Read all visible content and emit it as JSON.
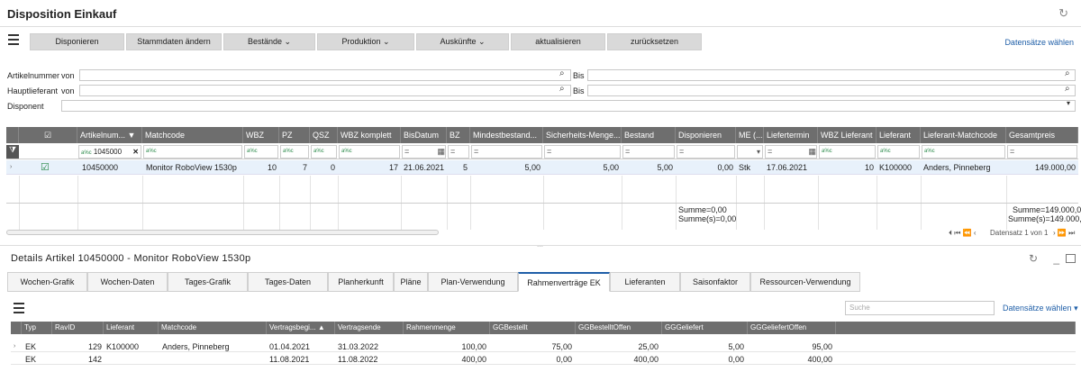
{
  "window": {
    "title": "Disposition Einkauf"
  },
  "toolbar": {
    "buttons": [
      "Disponieren",
      "Stammdaten ändern",
      "Bestände",
      "Produktion",
      "Auskünfte",
      "aktualisieren",
      "zurücksetzen"
    ],
    "datensaetze": "Datensätze wählen"
  },
  "filters": {
    "artikelnummer": "Artikelnummer",
    "hauptlieferant": "Hauptlieferant",
    "von": "von",
    "bis": "Bis",
    "disponent": "Disponent"
  },
  "grid": {
    "columns": [
      "Artikelnum...",
      "Matchcode",
      "WBZ",
      "PZ",
      "QSZ",
      "WBZ komplett",
      "BisDatum",
      "BZ",
      "Mindestbestand...",
      "Sicherheits-Menge...",
      "Bestand",
      "Disponieren",
      "ME (...",
      "Liefertermin",
      "WBZ Lieferant",
      "Lieferant",
      "Lieferant-Matchcode",
      "Gesamtpreis"
    ],
    "filter_artikel": "1045000",
    "row": {
      "artikel": "10450000",
      "matchcode": "Monitor RoboView 1530p",
      "wbz": "10",
      "pz": "7",
      "qsz": "0",
      "wbz_komplett": "17",
      "bisdatum": "21.06.2021",
      "bz": "5",
      "mindestbestand": "5,00",
      "sicherheit": "5,00",
      "bestand": "5,00",
      "disponieren": "0,00",
      "me": "Stk",
      "liefertermin": "17.06.2021",
      "wbz_lieferant": "10",
      "lieferant": "K100000",
      "lieferant_match": "Anders, Pinneberg",
      "gesamtpreis": "149.000,00"
    },
    "sum_disp_1": "Summe=0,00",
    "sum_disp_2": "Summe(s)=0,00",
    "sum_ges_1": "Summe=149.000,0(",
    "sum_ges_2": "Summe(s)=149.000,0(",
    "pager": "Datensatz 1 von 1"
  },
  "details": {
    "title": "Details Artikel 10450000 - Monitor RoboView 1530p",
    "tabs": [
      "Wochen-Grafik",
      "Wochen-Daten",
      "Tages-Grafik",
      "Tages-Daten",
      "Planherkunft",
      "Pläne",
      "Plan-Verwendung",
      "Rahmenverträge EK",
      "Lieferanten",
      "Saisonfaktor",
      "Ressourcen-Verwendung"
    ],
    "active_tab": "Rahmenverträge EK",
    "search_placeholder": "Suche",
    "datensaetze": "Datensätze wählen",
    "columns": [
      "Typ",
      "RavID",
      "Lieferant",
      "Matchcode",
      "Vertragsbegi...",
      "Vertragsende",
      "Rahmenmenge",
      "GGBestellt",
      "GGBestelltOffen",
      "GGGeliefert",
      "GGGeliefertOffen"
    ],
    "rows": [
      {
        "typ": "EK",
        "ravid": "129",
        "lieferant": "K100000",
        "matchcode": "Anders, Pinneberg",
        "beginn": "01.04.2021",
        "ende": "31.03.2022",
        "menge": "100,00",
        "bestellt": "75,00",
        "offen": "25,00",
        "geliefert": "5,00",
        "geloffen": "95,00"
      },
      {
        "typ": "EK",
        "ravid": "142",
        "lieferant": "",
        "matchcode": "",
        "beginn": "11.08.2021",
        "ende": "11.08.2022",
        "menge": "400,00",
        "bestellt": "0,00",
        "offen": "400,00",
        "geliefert": "0,00",
        "geloffen": "400,00"
      }
    ]
  }
}
